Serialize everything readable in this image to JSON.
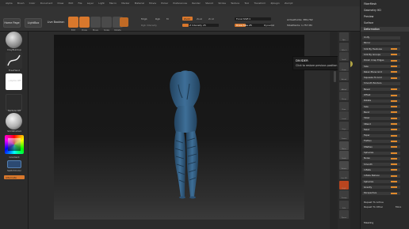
{
  "menu": [
    "Alpha",
    "Brush",
    "Color",
    "Document",
    "Draw",
    "Edit",
    "File",
    "Layer",
    "Light",
    "Macro",
    "Marker",
    "Material",
    "Movie",
    "Picker",
    "Preferences",
    "Render",
    "Stencil",
    "Stroke",
    "Texture",
    "Tool",
    "Transform",
    "Zplugin",
    "Zscript"
  ],
  "toolbar": {
    "home_page": "Home Page",
    "lightbox": "LightBox",
    "live_boolean": "Live Boolean",
    "tools": [
      {
        "label": "Edit",
        "active": true
      },
      {
        "label": "Draw",
        "active": true
      },
      {
        "label": "Move",
        "active": false
      },
      {
        "label": "Scale",
        "active": false
      },
      {
        "label": "Rotate",
        "active": false
      }
    ],
    "mrgb": "Mrgb",
    "rgb": "Rgb",
    "m": "M",
    "zadd": "Zadd",
    "zsub": "Zsub",
    "zcut": "Zcut",
    "rgb_intensity": "Rgb Intensity",
    "z_intensity": "Z Intensity 25",
    "focal_shift": "Focal Shift 0",
    "draw_size": "Draw Size 25",
    "dynamic": "Dynamic",
    "active_points": "ActivePoints: 389,762",
    "total_points": "TotalPoints: 1.757 Mil"
  },
  "left_shelf": {
    "brush_label": "ClayBuildup",
    "stroke_label": "FreeHand",
    "alpha_label": "~Alpha Off",
    "texture_label": "Texture Off",
    "material_label": "SkinShade4",
    "gradient_label": "Gradient",
    "switch_color_label": "SwitchColor",
    "alternate_label": "Alternate"
  },
  "tooltip": {
    "title": "DIVIDER",
    "text": "Click to restore previous position"
  },
  "right_icons": [
    "Bpr",
    "SPix 3",
    "Scroll",
    "Zoom",
    "Actual",
    "AAHalf",
    "Persp",
    "Floor",
    "Local",
    "Gxyz",
    "Frame",
    "Move",
    "Scale",
    "Rotate",
    "Line Fill",
    "PolyF",
    "Transp",
    "Solo",
    "Xpose"
  ],
  "palette": {
    "top_items": [
      "FiberMesh",
      "Geometry HD",
      "Preview",
      "Surface",
      "Deformation"
    ],
    "deformation_rows": [
      {
        "label": "Unify",
        "type": "plain"
      },
      {
        "label": "Mirror",
        "type": "plain"
      },
      {
        "label": "Smt By Features",
        "type": "slider"
      },
      {
        "label": "Smt By Groups",
        "type": "slider"
      },
      {
        "label": "Polish Crisp Edges",
        "type": "slider"
      },
      {
        "label": "Size",
        "type": "slider"
      },
      {
        "label": "Relax Plane Grid",
        "type": "slider"
      },
      {
        "label": "Squeeze To Grid",
        "type": "slider"
      },
      {
        "label": "Smooth Borders",
        "type": "plain"
      },
      {
        "label": "Bevel",
        "type": "slider"
      },
      {
        "label": "Offset",
        "type": "slider"
      },
      {
        "label": "Rotate",
        "type": "slider"
      },
      {
        "label": "Size",
        "type": "slider"
      },
      {
        "label": "Bend",
        "type": "slider"
      },
      {
        "label": "Skew",
        "type": "slider"
      },
      {
        "label": "SBend",
        "type": "slider"
      },
      {
        "label": "Twist",
        "type": "slider"
      },
      {
        "label": "Taper",
        "type": "slider"
      },
      {
        "label": "Flatten",
        "type": "slider"
      },
      {
        "label": "Sflatten",
        "type": "slider"
      },
      {
        "label": "Spherize",
        "type": "slider"
      },
      {
        "label": "Noise",
        "type": "slider"
      },
      {
        "label": "Smooth",
        "type": "slider"
      },
      {
        "label": "Inflate",
        "type": "slider"
      },
      {
        "label": "Inflate Balloon",
        "type": "slider"
      },
      {
        "label": "Spherize",
        "type": "slider"
      },
      {
        "label": "Gravity",
        "type": "slider"
      },
      {
        "label": "Perspective",
        "type": "slider"
      }
    ],
    "repeat_active": "Repeat To Active",
    "repeat_other": "Repeat To Other",
    "more": "More",
    "masking": "Masking"
  },
  "colors": {
    "accent": "#d9782c",
    "model_blue": "#3a6a95",
    "background": "#262626"
  }
}
